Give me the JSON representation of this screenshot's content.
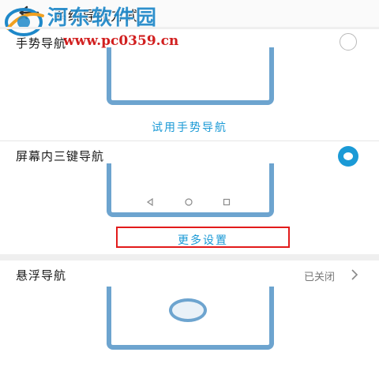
{
  "header": {
    "title": "系统导航方式",
    "back_icon": "back-arrow-icon"
  },
  "watermark": {
    "name": "河东软件园",
    "url": "www.pc0359.cn",
    "logo_icon": "watermark-logo-icon"
  },
  "options": [
    {
      "label": "手势导航",
      "selected": false,
      "link": "试用手势导航"
    },
    {
      "label": "屏幕内三键导航",
      "selected": true,
      "link": "更多设置"
    },
    {
      "label": "悬浮导航",
      "status": "已关闭"
    }
  ],
  "nav_keys_icons": [
    "back-triangle-icon",
    "home-circle-icon",
    "recent-square-icon"
  ],
  "colors": {
    "accent": "#1b9ad6",
    "phone_frame": "#6da4cf",
    "highlight_box": "#e21b1b"
  }
}
